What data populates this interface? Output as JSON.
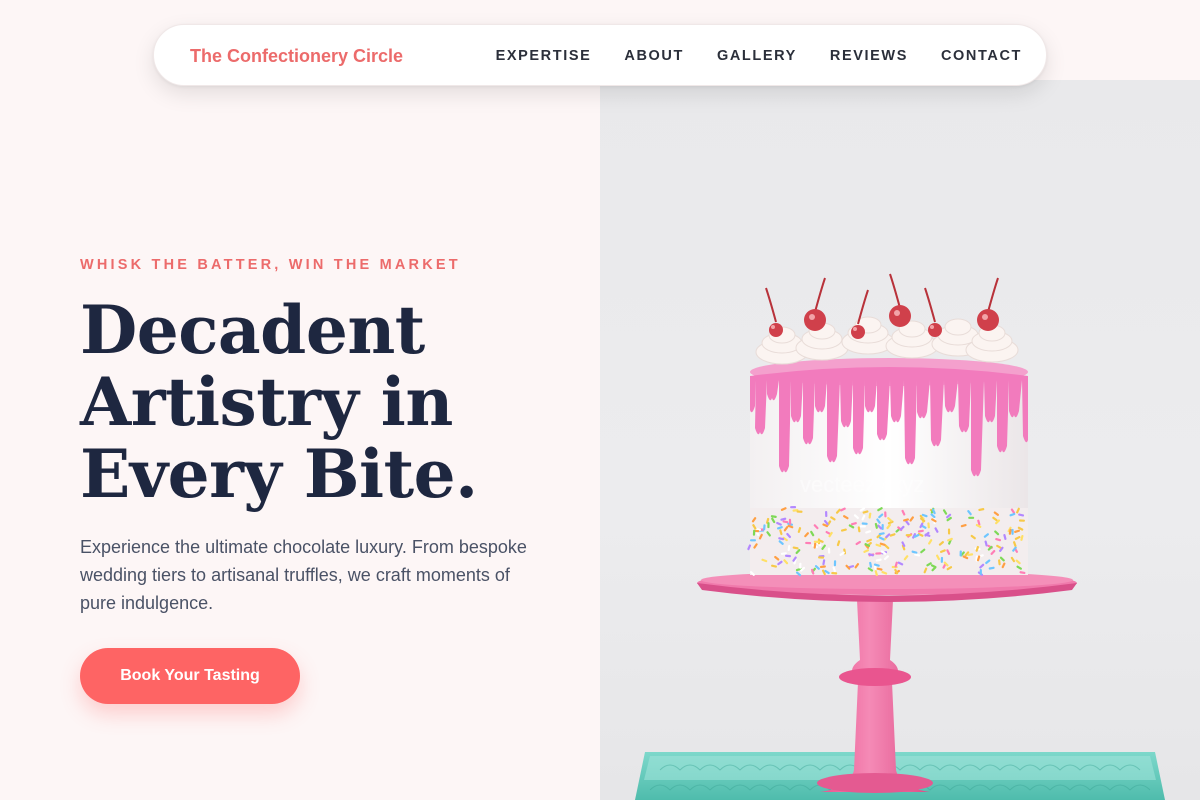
{
  "brand": {
    "name": "The Confectionery Circle"
  },
  "nav": {
    "items": [
      {
        "label": "EXPERTISE"
      },
      {
        "label": "ABOUT"
      },
      {
        "label": "GALLERY"
      },
      {
        "label": "REVIEWS"
      },
      {
        "label": "CONTACT"
      }
    ]
  },
  "hero": {
    "eyebrow": "WHISK THE BATTER, WIN THE MARKET",
    "headline_lines": [
      "Decadent",
      "Artistry in",
      "Every Bite."
    ],
    "lead": "Experience the ultimate chocolate luxury. From bespoke wedding tiers to artisanal truffles, we craft moments of pure indulgence.",
    "cta_label": "Book Your Tasting",
    "image": {
      "subject": "drip-cake-on-pink-stand",
      "watermark": "vecteezy.xyz"
    }
  },
  "colors": {
    "accent": "#ec6b6b",
    "button": "#fe6464",
    "heading": "#1e2740",
    "body_text": "#4a5266",
    "page_bg": "#fdf6f6",
    "icing_pink": "#f27bbd",
    "stand_pink": "#ee6fa4",
    "tray_teal": "#5cc9b9"
  }
}
